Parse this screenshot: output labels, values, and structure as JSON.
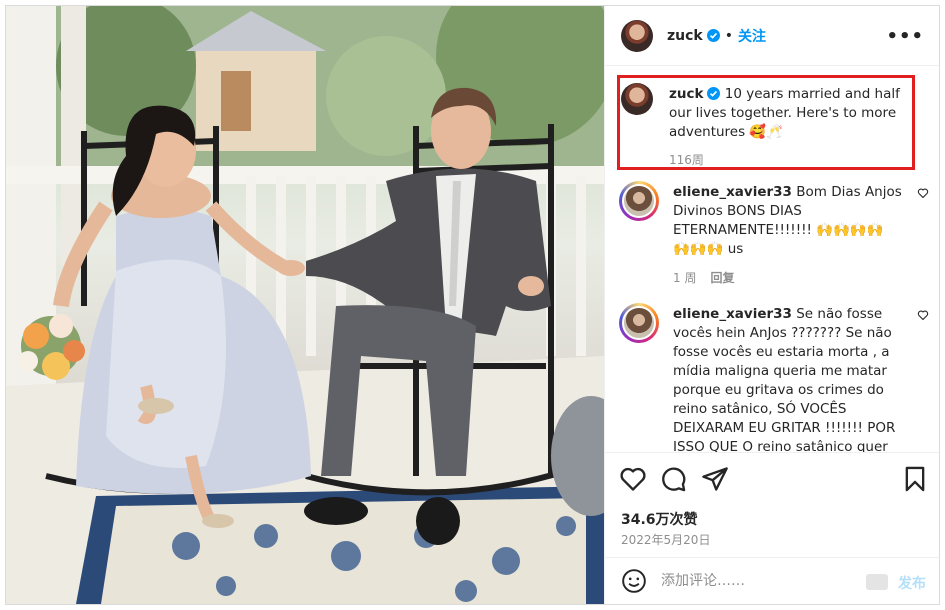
{
  "header": {
    "username": "zuck",
    "follow_label": "关注",
    "more_label": "•••"
  },
  "caption": {
    "username": "zuck",
    "text": "10 years married and half our lives together. Here's to more adventures 🥰🥂",
    "time": "116周"
  },
  "comments": [
    {
      "username": "eliene_xavier33",
      "text": "Bom Dias Anjos Divinos BONS DIAS ETERNAMENTE!!!!!!! 🙌🙌🙌🙌 🙌🙌🙌 us",
      "time": "1 周",
      "reply_label": "回复"
    },
    {
      "username": "eliene_xavier33",
      "text": "Se não fosse vocês hein AnJos ??????? Se não fosse vocês eu estaria morta , a mídia maligna queria me matar porque eu gritava os crimes do reino satânico, SÓ VOCÊS DEIXARAM EU GRITAR !!!!!!! POR ISSO QUE O reino satânico quer censuras",
      "time": "",
      "reply_label": ""
    }
  ],
  "likes": "34.6万次赞",
  "date": "2022年5月20日",
  "comment_box": {
    "placeholder": "添加评论……",
    "post_label": "发布"
  },
  "icons": {
    "like": "heart-icon",
    "comment": "comment-icon",
    "share": "share-icon",
    "save": "bookmark-icon",
    "emoji": "emoji-icon",
    "verified": "verified-badge-icon",
    "more": "more-options-icon"
  },
  "colors": {
    "accent": "#0095f6",
    "highlight_box": "#e02020",
    "post_disabled": "#b2dffc"
  }
}
